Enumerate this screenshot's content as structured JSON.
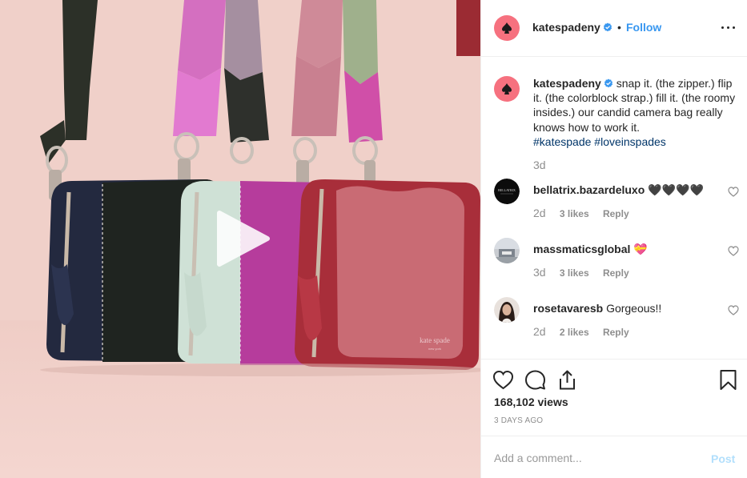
{
  "media": {
    "type": "video",
    "play_icon": "play-icon",
    "bag_logo_text": "kate spade",
    "bag_logo_subtext": "new york"
  },
  "post": {
    "username": "katespadeny",
    "verified": true,
    "separator": "•",
    "follow_label": "Follow",
    "more_icon": "more-options-icon",
    "caption": {
      "username": "katespadeny",
      "body": " snap it. (the zipper.) flip it. (the colorblock strap.) fill it. (the roomy insides.) our candid camera bag really knows how to work it.",
      "hashtags": [
        "#katespade",
        "#loveinspades"
      ],
      "age": "3d"
    },
    "comments": [
      {
        "username": "bellatrix.bazardeluxo",
        "text": "🖤🖤🖤🖤",
        "age": "3d",
        "likes": "",
        "reply_label": ""
      },
      {
        "username": "bellatrix.bazardeluxo",
        "text": "",
        "age": "2d",
        "likes": "3 likes",
        "reply_label": "Reply"
      }
    ],
    "views": "168,102 views",
    "timestamp": "3 DAYS AGO",
    "comment_placeholder": "Add a comment...",
    "post_label": "Post"
  },
  "comment_list": [
    {
      "username": "bellatrix.bazardeluxo",
      "text": "🖤🖤🖤🖤",
      "age": "2d",
      "likes": "3 likes",
      "reply_label": "Reply"
    },
    {
      "username": "massmaticsglobal",
      "text": "💝",
      "age": "3d",
      "likes": "3 likes",
      "reply_label": "Reply"
    },
    {
      "username": "rosetavaresb",
      "text": "Gorgeous!!",
      "age": "2d",
      "likes": "2 likes",
      "reply_label": "Reply"
    }
  ],
  "avatar_badge_text": "BELLATRIX",
  "colors": {
    "brand_pink": "#f6717f",
    "link_blue": "#3897f0",
    "hashtag_blue": "#003569",
    "muted": "#8e8e8e",
    "post_disabled": "#b2dffc"
  }
}
